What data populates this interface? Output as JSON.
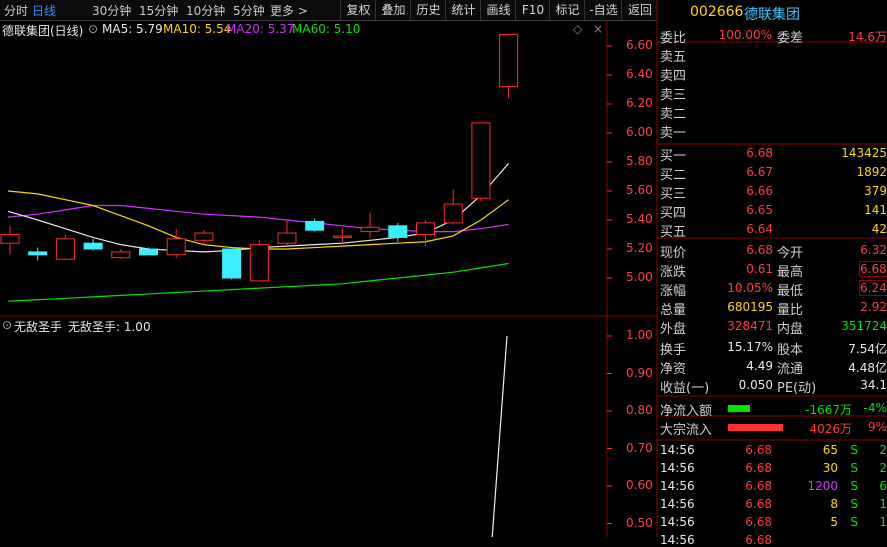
{
  "toolbar": {
    "periods": [
      "分时",
      "日线",
      "30分钟",
      "15分钟",
      "10分钟",
      "5分钟",
      "更多 >"
    ],
    "active_period": "日线",
    "buttons": [
      "复权",
      "叠加",
      "历史",
      "统计",
      "画线",
      "F10",
      "标记",
      "-自选",
      "返回"
    ]
  },
  "main_chart": {
    "stock": "德联集团(日线)",
    "ma5": "MA5: 5.79",
    "ma10": "MA10: 5.54",
    "ma20": "MA20: 5.37",
    "ma60": "MA60: 5.10"
  },
  "indicator_panel": {
    "name": "无敌圣手",
    "value_label": "无敌圣手: 1.00"
  },
  "quote": {
    "code": "002666",
    "name": "德联集团",
    "weibi_label": "委比",
    "weibi": "100.00%",
    "weicha_label": "委差",
    "weicha": "14.6万",
    "asks": [
      {
        "label": "卖五",
        "price": "",
        "vol": ""
      },
      {
        "label": "卖四",
        "price": "",
        "vol": ""
      },
      {
        "label": "卖三",
        "price": "",
        "vol": ""
      },
      {
        "label": "卖二",
        "price": "",
        "vol": ""
      },
      {
        "label": "卖一",
        "price": "",
        "vol": ""
      }
    ],
    "bids": [
      {
        "label": "买一",
        "price": "6.68",
        "vol": "143425"
      },
      {
        "label": "买二",
        "price": "6.67",
        "vol": "1892"
      },
      {
        "label": "买三",
        "price": "6.66",
        "vol": "379"
      },
      {
        "label": "买四",
        "price": "6.65",
        "vol": "141"
      },
      {
        "label": "买五",
        "price": "6.64",
        "vol": "42"
      }
    ],
    "stats": [
      {
        "l1": "现价",
        "v1": "6.68",
        "l2": "今开",
        "v2": "6.32"
      },
      {
        "l1": "涨跌",
        "v1": "0.61",
        "l2": "最高",
        "v2": "6.68"
      },
      {
        "l1": "涨幅",
        "v1": "10.05%",
        "l2": "最低",
        "v2": "6.24"
      },
      {
        "l1": "总量",
        "v1": "680195",
        "l2": "量比",
        "v2": "2.92"
      },
      {
        "l1": "外盘",
        "v1": "328471",
        "l2": "内盘",
        "v2": "351724"
      }
    ],
    "stats2": [
      {
        "l1": "换手",
        "v1": "15.17%",
        "l2": "股本",
        "v2": "7.54亿"
      },
      {
        "l1": "净资",
        "v1": "4.49",
        "l2": "流通",
        "v2": "4.48亿"
      },
      {
        "l1": "收益(一)",
        "v1": "0.050",
        "l2": "PE(动)",
        "v2": "34.1"
      }
    ],
    "flow": [
      {
        "label": "净流入额",
        "value": "-1667万",
        "pct": "-4%",
        "color": "#00e400"
      },
      {
        "label": "大宗流入",
        "value": "4026万",
        "pct": "9%",
        "color": "#ff3030"
      }
    ],
    "ticks": [
      {
        "time": "14:56",
        "price": "6.68",
        "vol": "65",
        "side": "S",
        "n": "2"
      },
      {
        "time": "14:56",
        "price": "6.68",
        "vol": "30",
        "side": "S",
        "n": "2"
      },
      {
        "time": "14:56",
        "price": "6.68",
        "vol": "1200",
        "side": "S",
        "n": "6"
      },
      {
        "time": "14:56",
        "price": "6.68",
        "vol": "8",
        "side": "S",
        "n": "1"
      },
      {
        "time": "14:56",
        "price": "6.68",
        "vol": "5",
        "side": "S",
        "n": "1"
      },
      {
        "time": "14:56",
        "price": "6.68",
        "vol": "",
        "side": "",
        "n": ""
      }
    ]
  },
  "price_axis": [
    "6.60",
    "6.40",
    "6.20",
    "6.00",
    "5.80",
    "5.60",
    "5.40",
    "5.20",
    "5.00"
  ],
  "indicator_axis": [
    "1.00",
    "0.90",
    "0.80",
    "0.70",
    "0.60",
    "0.50"
  ],
  "candles": [
    {
      "o": 5.24,
      "c": 5.3,
      "h": 5.36,
      "l": 5.16
    },
    {
      "o": 5.18,
      "c": 5.16,
      "h": 5.21,
      "l": 5.12
    },
    {
      "o": 5.13,
      "c": 5.27,
      "h": 5.3,
      "l": 5.13
    },
    {
      "o": 5.24,
      "c": 5.2,
      "h": 5.27,
      "l": 5.19
    },
    {
      "o": 5.14,
      "c": 5.18,
      "h": 5.2,
      "l": 5.13
    },
    {
      "o": 5.2,
      "c": 5.16,
      "h": 5.21,
      "l": 5.16
    },
    {
      "o": 5.16,
      "c": 5.27,
      "h": 5.34,
      "l": 5.14
    },
    {
      "o": 5.26,
      "c": 5.31,
      "h": 5.33,
      "l": 5.23
    },
    {
      "o": 5.2,
      "c": 5.0,
      "h": 5.2,
      "l": 4.99
    },
    {
      "o": 4.98,
      "c": 5.23,
      "h": 5.26,
      "l": 4.98
    },
    {
      "o": 5.24,
      "c": 5.31,
      "h": 5.4,
      "l": 5.22
    },
    {
      "o": 5.39,
      "c": 5.33,
      "h": 5.41,
      "l": 5.32
    },
    {
      "o": 5.29,
      "c": 5.29,
      "h": 5.34,
      "l": 5.24
    },
    {
      "o": 5.32,
      "c": 5.35,
      "h": 5.45,
      "l": 5.28
    },
    {
      "o": 5.36,
      "c": 5.28,
      "h": 5.38,
      "l": 5.25
    },
    {
      "o": 5.3,
      "c": 5.38,
      "h": 5.4,
      "l": 5.22
    },
    {
      "o": 5.38,
      "c": 5.51,
      "h": 5.61,
      "l": 5.37
    },
    {
      "o": 5.55,
      "c": 6.07,
      "h": 6.07,
      "l": 5.53
    },
    {
      "o": 6.32,
      "c": 6.68,
      "h": 6.68,
      "l": 6.24
    }
  ],
  "ma": {
    "ma5": [
      5.46,
      5.4,
      5.34,
      5.28,
      5.23,
      5.2,
      5.19,
      5.18,
      5.19,
      5.21,
      5.22,
      5.23,
      5.24,
      5.26,
      5.28,
      5.31,
      5.4,
      5.57,
      5.79
    ],
    "ma10": [
      5.6,
      5.58,
      5.54,
      5.5,
      5.43,
      5.36,
      5.28,
      5.23,
      5.21,
      5.2,
      5.2,
      5.21,
      5.22,
      5.23,
      5.24,
      5.25,
      5.29,
      5.4,
      5.54
    ],
    "ma20": [
      5.42,
      5.44,
      5.47,
      5.5,
      5.5,
      5.48,
      5.46,
      5.44,
      5.43,
      5.42,
      5.4,
      5.38,
      5.36,
      5.34,
      5.33,
      5.32,
      5.32,
      5.34,
      5.37
    ],
    "ma60": [
      4.84,
      4.85,
      4.86,
      4.87,
      4.88,
      4.89,
      4.9,
      4.91,
      4.92,
      4.93,
      4.94,
      4.95,
      4.96,
      4.98,
      5.0,
      5.02,
      5.04,
      5.07,
      5.1
    ]
  },
  "indicator_series": [
    0.0,
    1.0
  ],
  "colors": {
    "up": "#ff2a2a",
    "down": "#39f0ff",
    "ma5": "#e8e8e8",
    "ma10": "#ffd700",
    "ma20": "#d030ff",
    "ma60": "#00e400",
    "grid": "#5a0000"
  }
}
